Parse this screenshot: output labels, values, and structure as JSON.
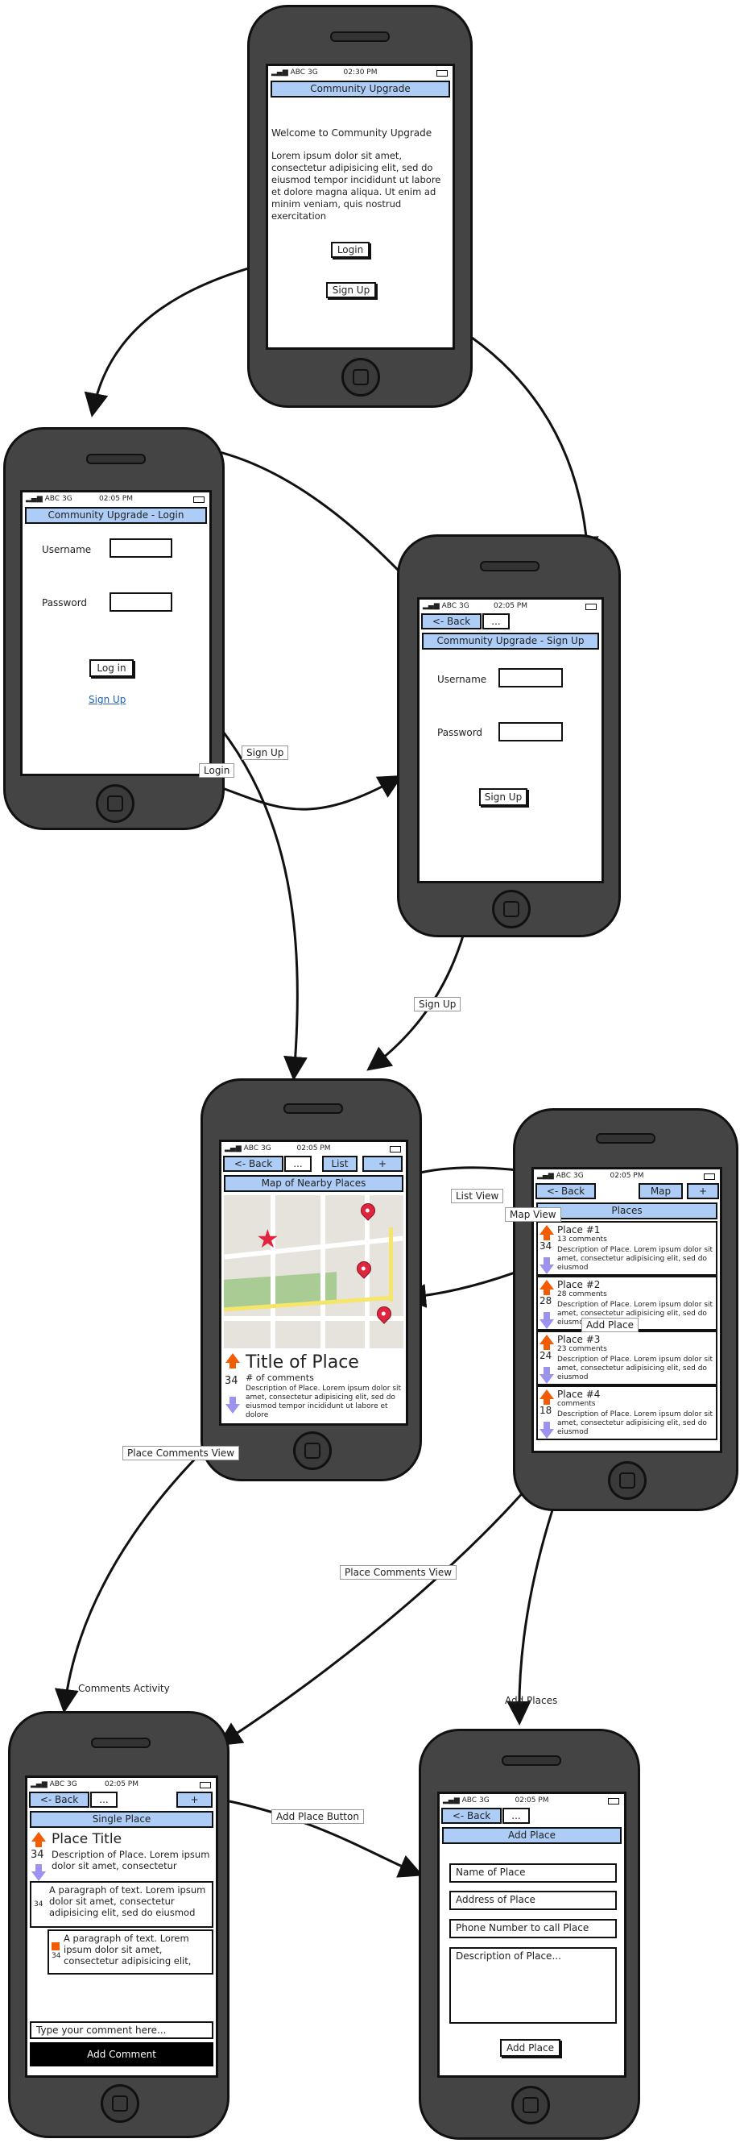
{
  "status": {
    "carrier": "ABC",
    "network": "3G"
  },
  "screens": {
    "welcome": {
      "time": "02:30 PM",
      "title": "Community Upgrade",
      "heading": "Welcome to Community Upgrade",
      "paragraph": "Lorem ipsum dolor sit amet, consectetur adipisicing elit, sed do eiusmod tempor incididunt ut labore et dolore magna aliqua. Ut enim ad minim veniam, quis nostrud exercitation",
      "login_button": "Login",
      "signup_button": "Sign Up"
    },
    "login": {
      "time": "02:05 PM",
      "title": "Community Upgrade - Login",
      "username_label": "Username",
      "password_label": "Password",
      "login_button": "Log in",
      "signup_link": "Sign Up"
    },
    "signup": {
      "time": "02:05 PM",
      "back_button": "<- Back",
      "extra_button": "...",
      "title": "Community Upgrade - Sign Up",
      "username_label": "Username",
      "password_label": "Password",
      "signup_button": "Sign Up"
    },
    "map": {
      "time": "02:05 PM",
      "back_button": "<- Back",
      "extra_button": "...",
      "list_button": "List",
      "add_button": "+",
      "title": "Map of Nearby Places",
      "place_title": "Title of Place",
      "votes": "34",
      "comments": "# of comments",
      "description": "Description of Place. Lorem ipsum dolor sit amet, consectetur adipisicing elit, sed do eiusmod tempor incididunt ut labore et dolore"
    },
    "places": {
      "time": "02:05 PM",
      "back_button": "<- Back",
      "map_button": "Map",
      "add_button": "+",
      "title": "Places",
      "items": [
        {
          "name": "Place #1",
          "votes": "34",
          "comments": "13 comments",
          "description": "Description of Place. Lorem ipsum dolor sit amet, consectetur adipisicing elit, sed do eiusmod"
        },
        {
          "name": "Place #2",
          "votes": "28",
          "comments": "28 comments",
          "description": "Description of Place. Lorem ipsum dolor sit amet, consectetur adipisicing elit, sed do eiusmod"
        },
        {
          "name": "Place #3",
          "votes": "24",
          "comments": "23 comments",
          "description": "Description of Place. Lorem ipsum dolor sit amet, consectetur adipisicing elit, sed do eiusmod"
        },
        {
          "name": "Place #4",
          "votes": "18",
          "comments": "comments",
          "description": "Description of Place. Lorem ipsum dolor sit amet, consectetur adipisicing elit, sed do eiusmod"
        }
      ]
    },
    "single": {
      "time": "02:05 PM",
      "back_button": "<- Back",
      "extra_button": "...",
      "add_button": "+",
      "title": "Single Place",
      "place_title": "Place Title",
      "votes": "34",
      "description": "Description of Place. Lorem ipsum dolor sit amet, consectetur",
      "comment1_votes": "34",
      "comment1": "A paragraph of text. Lorem ipsum dolor sit amet, consectetur adipisicing elit, sed do eiusmod",
      "comment2_votes": "34",
      "comment2": "A paragraph of text. Lorem ipsum dolor sit amet, consectetur adipisicing elit,",
      "comment_placeholder": "Type your comment here...",
      "add_comment_button": "Add Comment"
    },
    "add_place": {
      "time": "02:05 PM",
      "back_button": "<- Back",
      "extra_button": "...",
      "title": "Add Place",
      "name_placeholder": "Name of Place",
      "address_placeholder": "Address of Place",
      "phone_placeholder": "Phone Number to call Place",
      "description_placeholder": "Description of Place...",
      "add_button": "Add Place"
    }
  },
  "flow_labels": {
    "signup": "Sign Up",
    "login": "Login",
    "signup2": "Sign Up",
    "list_view": "List View",
    "map_view": "Map View",
    "add_place": "Add Place",
    "place_comments_view_1": "Place Comments View",
    "place_comments_view_2": "Place Comments View",
    "comments_activity": "Comments Activity",
    "add_places": "Add Places",
    "add_place_button": "Add Place Button"
  },
  "colors": {
    "titlebar": "#aecdf6",
    "phone_body": "#444444",
    "upvote": "#f25c05",
    "downvote": "#9b93ee",
    "link": "#1e5fb8"
  }
}
